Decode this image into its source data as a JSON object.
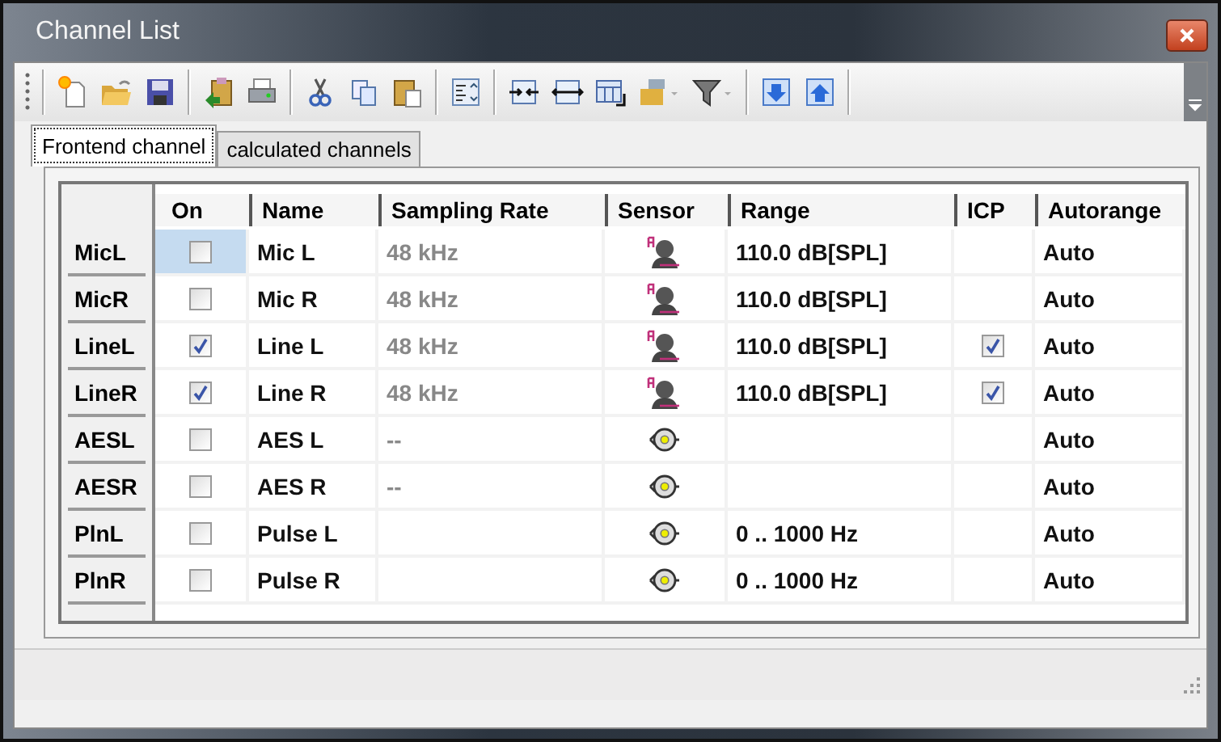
{
  "window": {
    "title": "Channel List"
  },
  "tabs": [
    {
      "label": "Frontend channel",
      "selected": true
    },
    {
      "label": "calculated channels",
      "selected": false
    }
  ],
  "table": {
    "columns": [
      "On",
      "Name",
      "Sampling Rate",
      "Sensor",
      "Range",
      "ICP",
      "Autorange"
    ],
    "rows": [
      {
        "header": "MicL",
        "on": false,
        "selected": true,
        "name": "Mic L",
        "sampling_rate": "48 kHz",
        "kind": "microphone",
        "range": "110.0 dB[SPL]",
        "autorange": "Auto"
      },
      {
        "header": "MicR",
        "on": false,
        "selected": false,
        "name": "Mic R",
        "sampling_rate": "48 kHz",
        "kind": "microphone",
        "range": "110.0 dB[SPL]",
        "autorange": "Auto"
      },
      {
        "header": "LineL",
        "on": true,
        "selected": false,
        "name": "Line L",
        "sampling_rate": "48 kHz",
        "kind": "microphone",
        "range": "110.0 dB[SPL]",
        "icp": {
          "checked": true
        },
        "autorange": "Auto"
      },
      {
        "header": "LineR",
        "on": true,
        "selected": false,
        "name": "Line R",
        "sampling_rate": "48 kHz",
        "kind": "microphone",
        "range": "110.0 dB[SPL]",
        "icp": {
          "checked": true
        },
        "autorange": "Auto"
      },
      {
        "header": "AESL",
        "on": false,
        "selected": false,
        "name": "AES L",
        "sampling_rate": "--",
        "kind": "connector",
        "autorange": "Auto"
      },
      {
        "header": "AESR",
        "on": false,
        "selected": false,
        "name": "AES R",
        "sampling_rate": "--",
        "kind": "connector",
        "autorange": "Auto"
      },
      {
        "header": "PlnL",
        "on": false,
        "selected": false,
        "name": "Pulse L",
        "kind": "connector",
        "range": "0 .. 1000 Hz",
        "autorange": "Auto"
      },
      {
        "header": "PlnR",
        "on": false,
        "selected": false,
        "name": "Pulse R",
        "kind": "connector",
        "range": "0 .. 1000 Hz",
        "autorange": "Auto"
      }
    ]
  }
}
